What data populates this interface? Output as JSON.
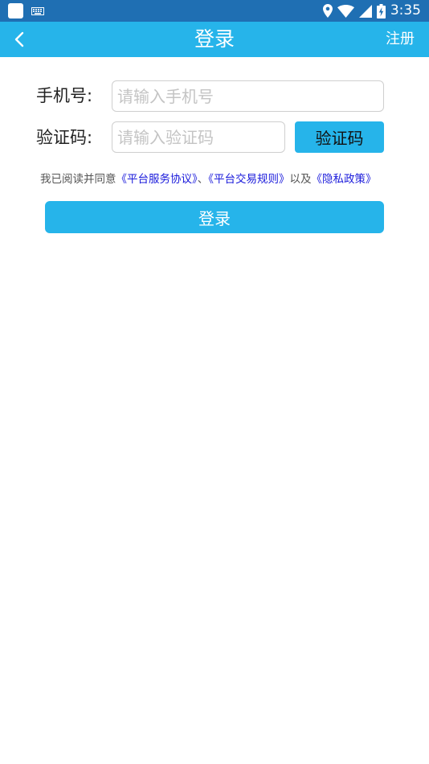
{
  "status_bar": {
    "time": "3:35",
    "icons": [
      "app-square-icon",
      "keyboard-icon",
      "location-icon",
      "wifi-icon",
      "signal-icon",
      "battery-charging-icon"
    ]
  },
  "app_bar": {
    "back_icon": "chevron-left-icon",
    "title": "登录",
    "register_label": "注册"
  },
  "form": {
    "phone_label": "手机号:",
    "phone_placeholder": "请输入手机号",
    "phone_value": "",
    "code_label": "验证码:",
    "code_placeholder": "请输入验证码",
    "code_value": "",
    "code_button_label": "验证码"
  },
  "agreement": {
    "prefix": "我已阅读并同意",
    "service_link": "《平台服务协议》",
    "separator": "、",
    "trade_link": "《平台交易规则》",
    "conjunction": "以及",
    "privacy_link": "《隐私政策》"
  },
  "login_button_label": "登录",
  "colors": {
    "status_bar": "#1f6fb3",
    "accent": "#26b4ea",
    "link": "#1a1adb",
    "placeholder": "#c4c4c4"
  }
}
